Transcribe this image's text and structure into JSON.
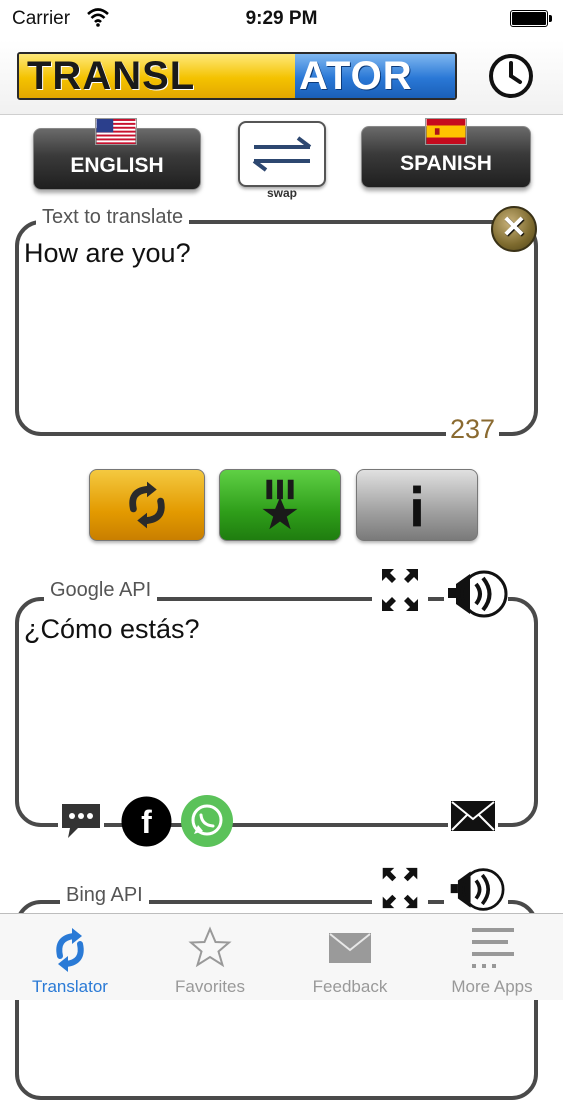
{
  "status_bar": {
    "carrier": "Carrier",
    "time": "9:29 PM"
  },
  "header": {
    "logo_part1": "TRANSL",
    "logo_part2": "ATOR",
    "history_icon": "clock-icon"
  },
  "languages": {
    "source": "ENGLISH",
    "target": "SPANISH",
    "swap_label": "swap"
  },
  "input": {
    "legend": "Text to translate",
    "text": "How are you?",
    "counter": "237"
  },
  "results": [
    {
      "legend": "Google API",
      "text": "¿Cómo estás?"
    },
    {
      "legend": "Bing API",
      "text": ""
    }
  ],
  "tabs": [
    {
      "label": "Translator",
      "icon": "translate-icon",
      "active": true
    },
    {
      "label": "Favorites",
      "icon": "star-icon",
      "active": false
    },
    {
      "label": "Feedback",
      "icon": "mail-icon",
      "active": false
    },
    {
      "label": "More Apps",
      "icon": "list-icon",
      "active": false
    }
  ],
  "colors": {
    "accent": "#2a7ad6",
    "frame": "#4a4a4a",
    "counter": "#8a6a30"
  }
}
